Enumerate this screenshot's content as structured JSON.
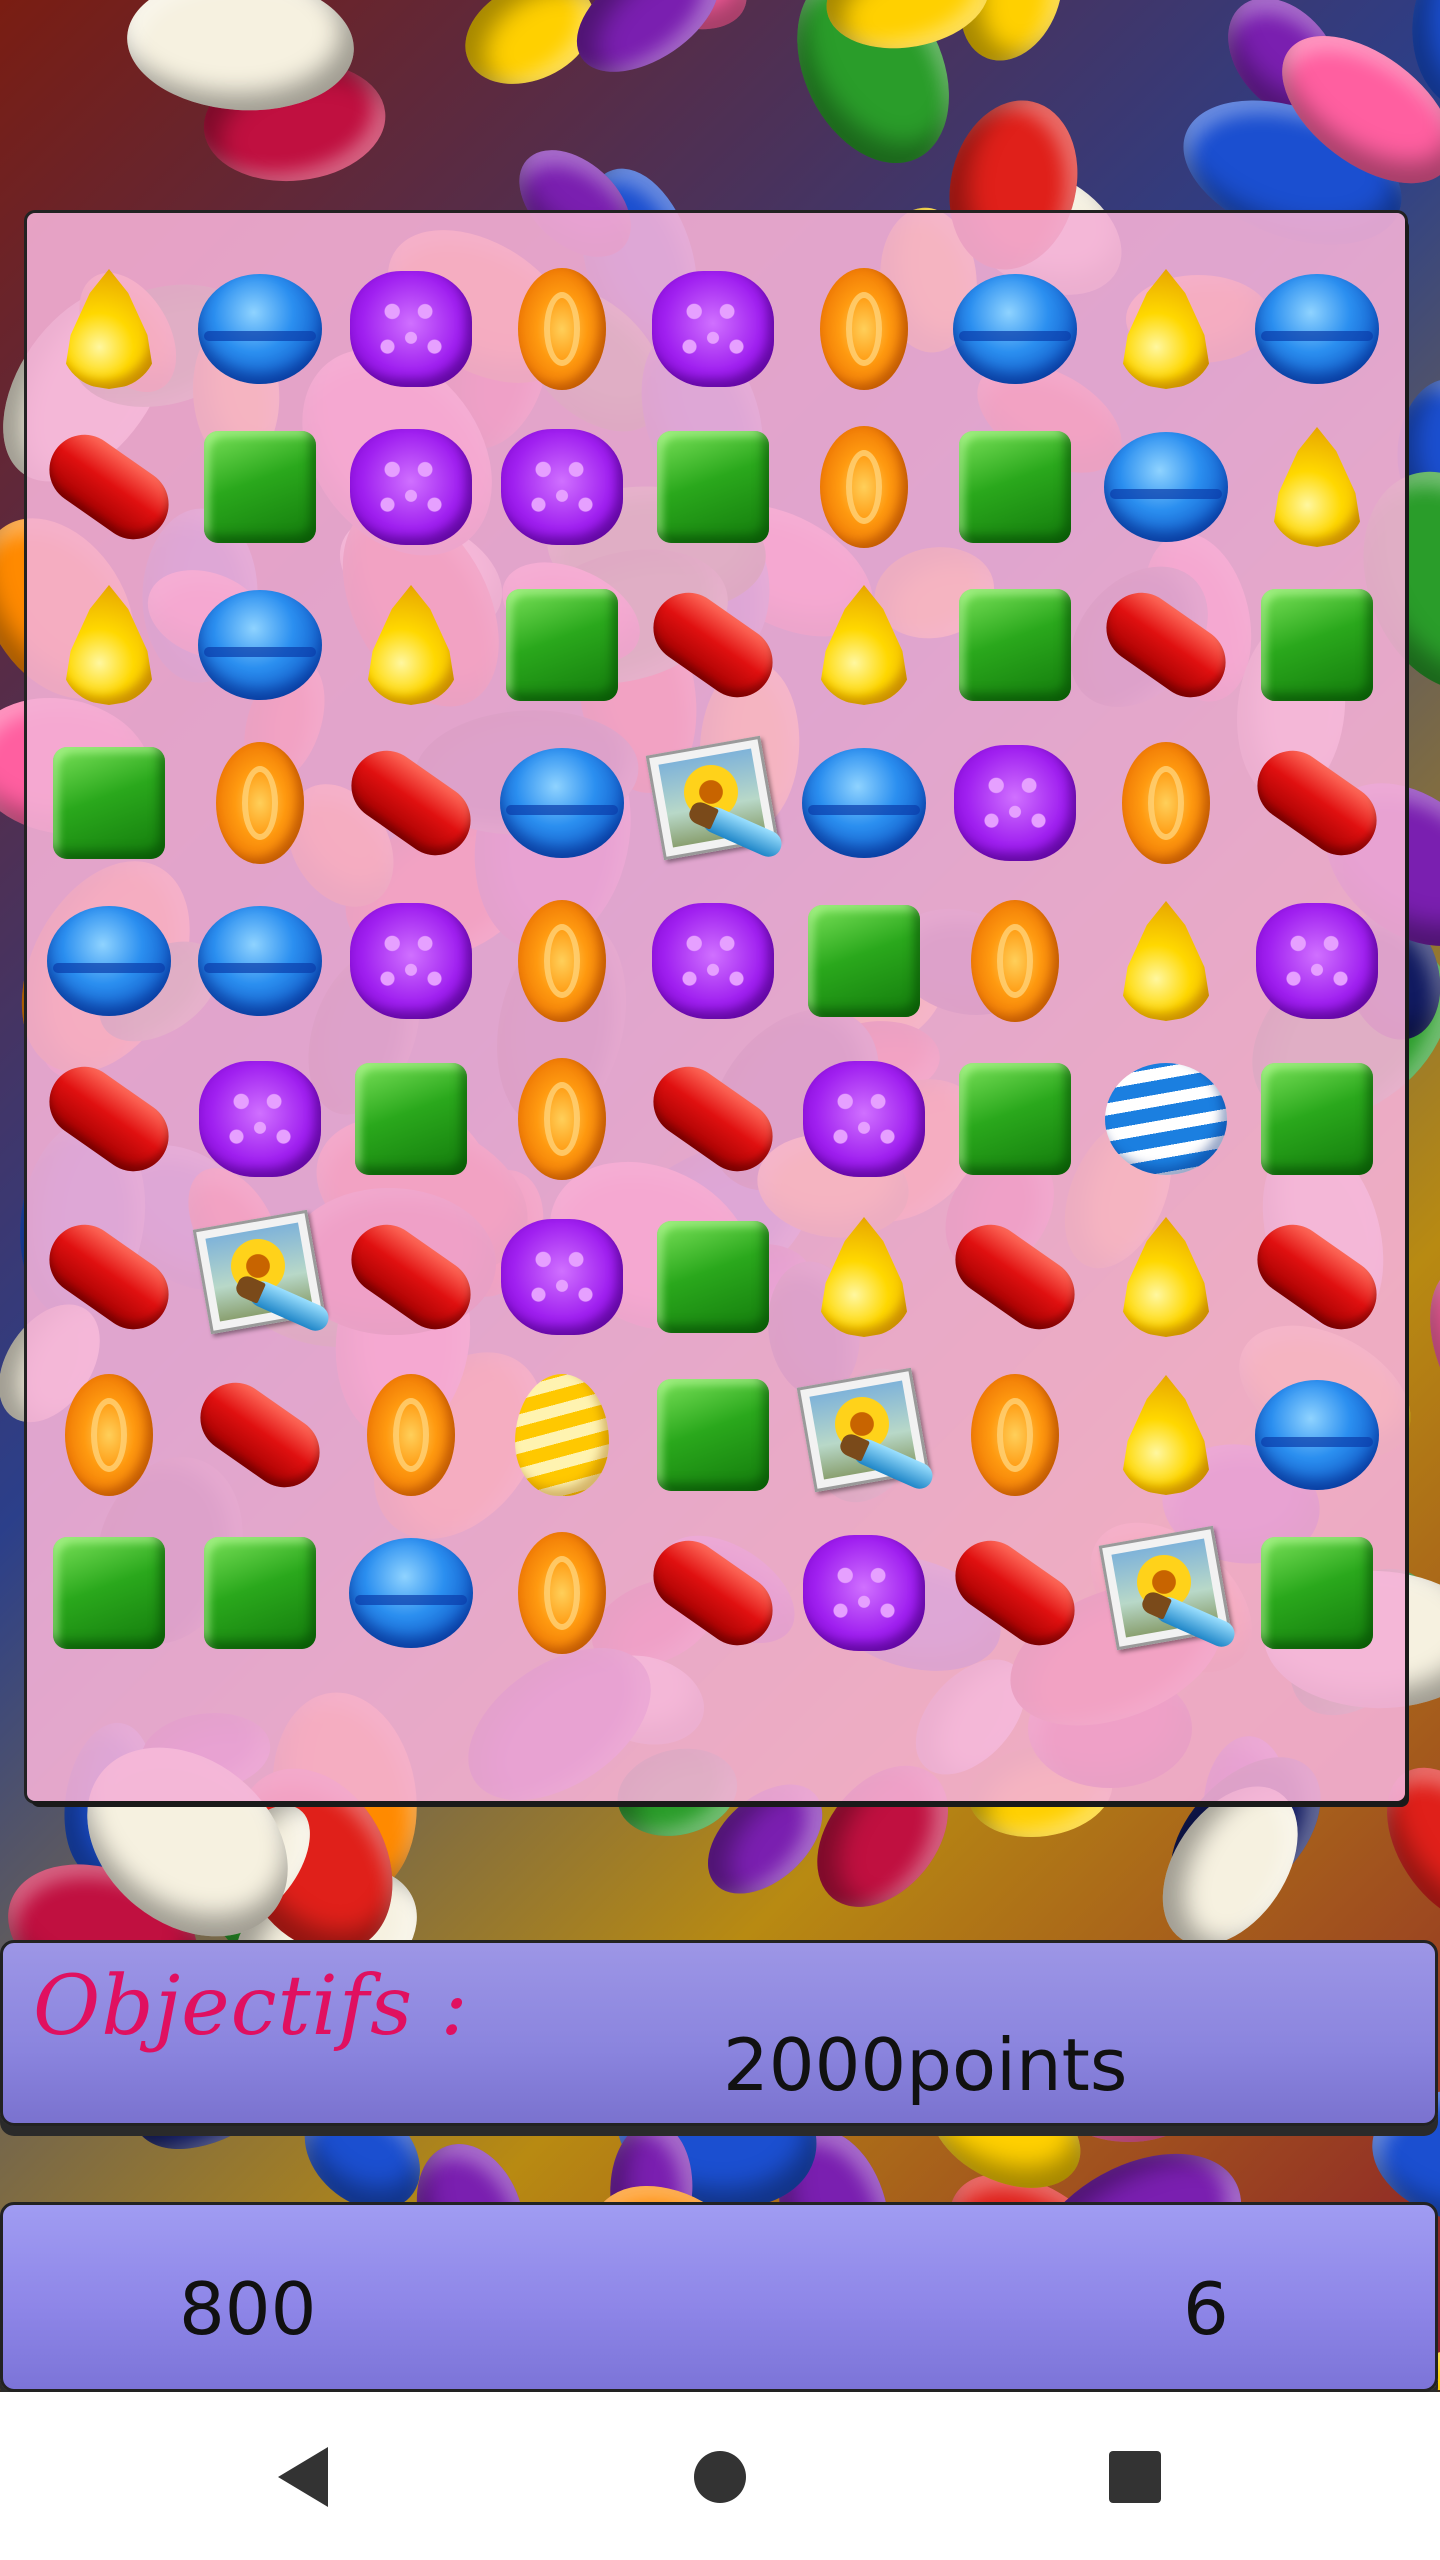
{
  "objectives": {
    "label": "Objectifs :",
    "target": "2000points"
  },
  "status": {
    "score": "800",
    "moves": "6"
  },
  "board": {
    "rows": [
      [
        "yellow",
        "blue",
        "purple",
        "orange",
        "purple",
        "orange",
        "blue",
        "yellow",
        "blue"
      ],
      [
        "red",
        "green",
        "purple",
        "purple",
        "green",
        "orange",
        "green",
        "blue",
        "yellow"
      ],
      [
        "yellow",
        "blue",
        "yellow",
        "green",
        "red",
        "yellow",
        "green",
        "red",
        "green"
      ],
      [
        "green",
        "orange",
        "red",
        "blue",
        "bonus",
        "blue",
        "purple",
        "orange",
        "red"
      ],
      [
        "blue",
        "blue",
        "purple",
        "orange",
        "purple",
        "green",
        "orange",
        "yellow",
        "purple"
      ],
      [
        "red",
        "purple",
        "green",
        "orange",
        "red",
        "purple",
        "green",
        "striped-blue",
        "green"
      ],
      [
        "red",
        "bonus",
        "red",
        "purple",
        "green",
        "yellow",
        "red",
        "yellow",
        "red"
      ],
      [
        "orange",
        "red",
        "orange",
        "striped-yellow",
        "green",
        "bonus",
        "orange",
        "yellow",
        "blue"
      ],
      [
        "green",
        "green",
        "blue",
        "orange",
        "red",
        "purple",
        "red",
        "bonus",
        "green"
      ]
    ]
  },
  "navbar": {
    "back": "back-icon",
    "home": "home-icon",
    "recents": "recents-icon"
  }
}
